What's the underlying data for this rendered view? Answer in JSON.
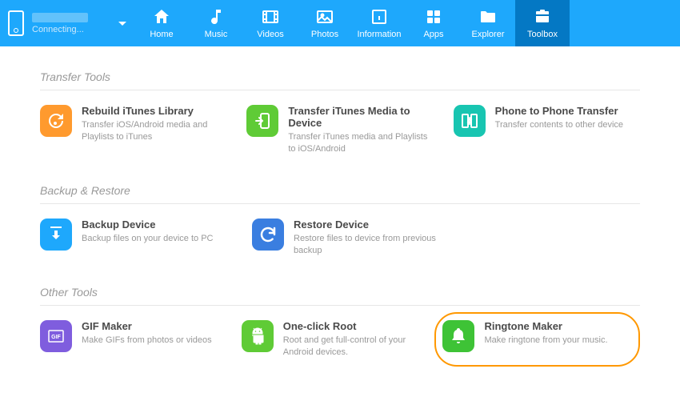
{
  "device": {
    "status": "Connecting..."
  },
  "nav": [
    {
      "label": "Home"
    },
    {
      "label": "Music"
    },
    {
      "label": "Videos"
    },
    {
      "label": "Photos"
    },
    {
      "label": "Information"
    },
    {
      "label": "Apps"
    },
    {
      "label": "Explorer"
    },
    {
      "label": "Toolbox"
    }
  ],
  "sections": {
    "transfer": {
      "title": "Transfer Tools",
      "items": [
        {
          "title": "Rebuild iTunes Library",
          "desc": "Transfer iOS/Android media and Playlists to iTunes"
        },
        {
          "title": "Transfer iTunes Media to Device",
          "desc": "Transfer iTunes media and Playlists to iOS/Android"
        },
        {
          "title": "Phone to Phone Transfer",
          "desc": "Transfer contents to other device"
        }
      ]
    },
    "backup": {
      "title": "Backup & Restore",
      "items": [
        {
          "title": "Backup Device",
          "desc": "Backup files on your device to PC"
        },
        {
          "title": "Restore Device",
          "desc": "Restore files to device from previous backup"
        }
      ]
    },
    "other": {
      "title": "Other Tools",
      "items": [
        {
          "title": "GIF Maker",
          "desc": "Make GIFs from photos or videos"
        },
        {
          "title": "One-click Root",
          "desc": "Root and get full-control of your Android devices."
        },
        {
          "title": "Ringtone Maker",
          "desc": "Make ringtone from your music."
        }
      ]
    }
  },
  "colors": {
    "orange": "#ff9a2e",
    "green": "#5fcb36",
    "teal": "#18c5b1",
    "blue": "#1ea8fc",
    "purple": "#7f5dde",
    "darkblue": "#3a7ee0",
    "green2": "#3ec336"
  }
}
